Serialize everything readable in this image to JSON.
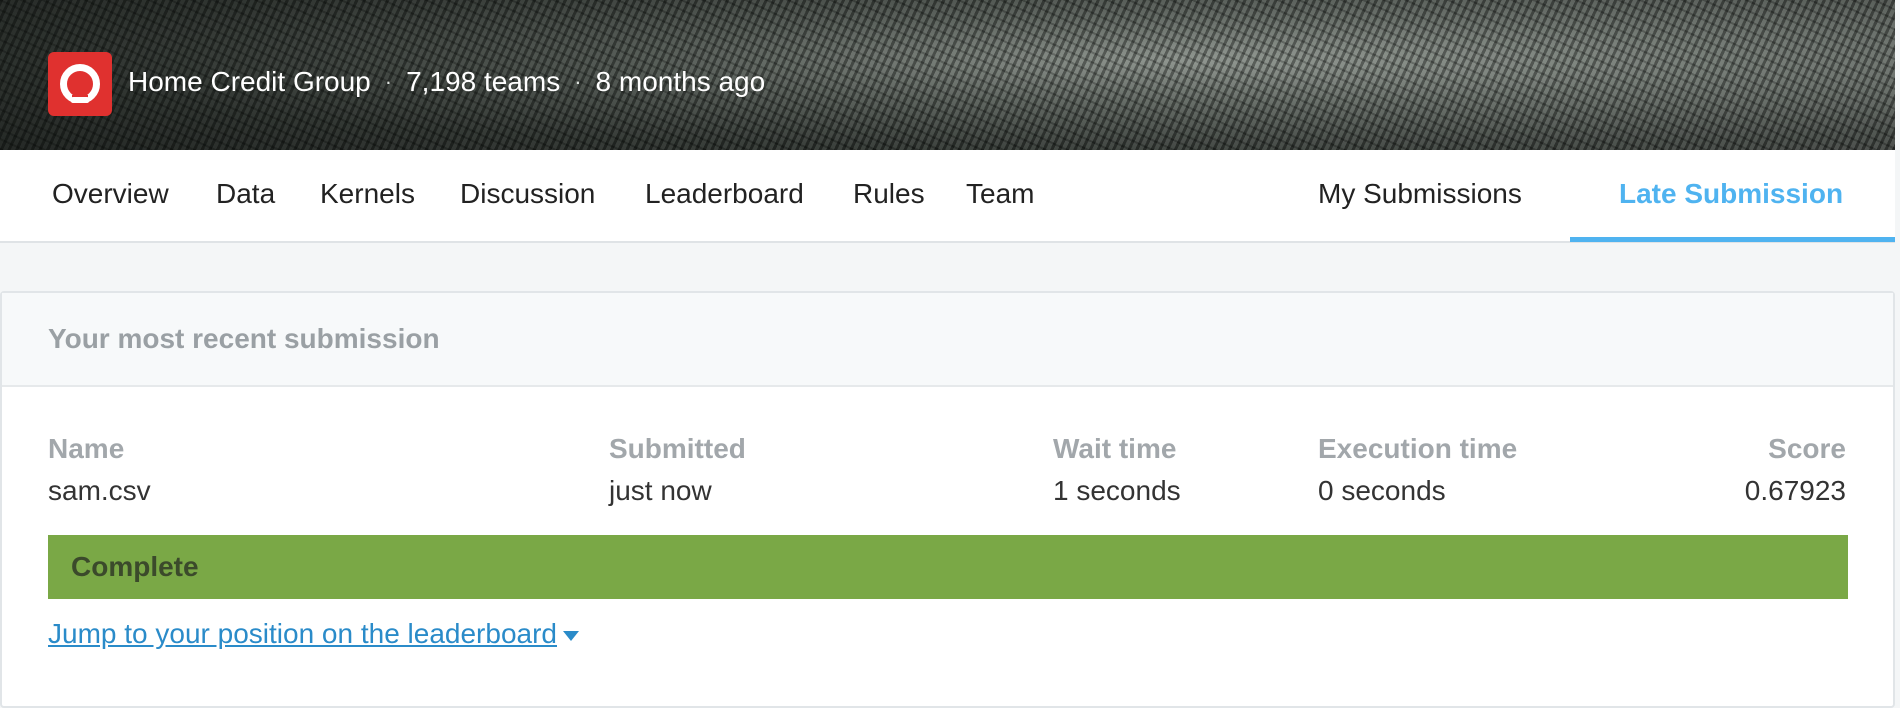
{
  "competition": {
    "host": "Home Credit Group",
    "teams": "7,198 teams",
    "age": "8 months ago",
    "separator": "·"
  },
  "nav": {
    "tabs": [
      {
        "label": "Overview"
      },
      {
        "label": "Data"
      },
      {
        "label": "Kernels"
      },
      {
        "label": "Discussion"
      },
      {
        "label": "Leaderboard"
      },
      {
        "label": "Rules"
      },
      {
        "label": "Team"
      }
    ],
    "my_submissions": "My Submissions",
    "late_submission": "Late Submission",
    "active_tab": "Late Submission",
    "accent_color": "#4fb3f0"
  },
  "submission": {
    "header": "Your most recent submission",
    "columns": {
      "name": {
        "label": "Name",
        "value": "sam.csv"
      },
      "submitted": {
        "label": "Submitted",
        "value": "just now"
      },
      "wait_time": {
        "label": "Wait time",
        "value": "1 seconds"
      },
      "execution_time": {
        "label": "Execution time",
        "value": "0 seconds"
      },
      "score": {
        "label": "Score",
        "value": "0.67923"
      }
    },
    "status": "Complete",
    "status_color": "#7aa846",
    "jump_link": "Jump to your position on the leaderboard"
  },
  "icons": {
    "logo": "home-credit-logo-icon",
    "caret": "caret-down-icon"
  }
}
